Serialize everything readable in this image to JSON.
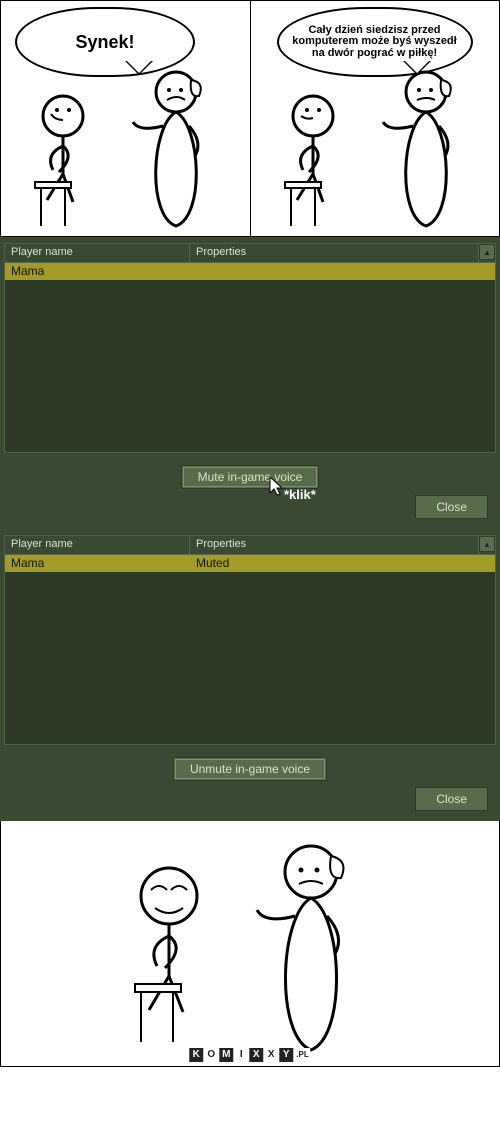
{
  "comic": {
    "panel1_text": "Synek!",
    "panel2_text": "Cały dzień siedzisz przed komputerem może byś wyszedł na dwór pograć w piłkę!"
  },
  "game1": {
    "header_name": "Player name",
    "header_prop": "Properties",
    "row_name": "Mama",
    "row_prop": "",
    "mute_btn": "Mute in-game voice",
    "close_btn": "Close",
    "klik": "*klik*"
  },
  "game2": {
    "header_name": "Player name",
    "header_prop": "Properties",
    "row_name": "Mama",
    "row_prop": "Muted",
    "unmute_btn": "Unmute in-game voice",
    "close_btn": "Close"
  },
  "watermark": {
    "letters": [
      "K",
      "O",
      "M",
      "I",
      "X",
      "X",
      "Y"
    ],
    "suffix": ".PL"
  }
}
